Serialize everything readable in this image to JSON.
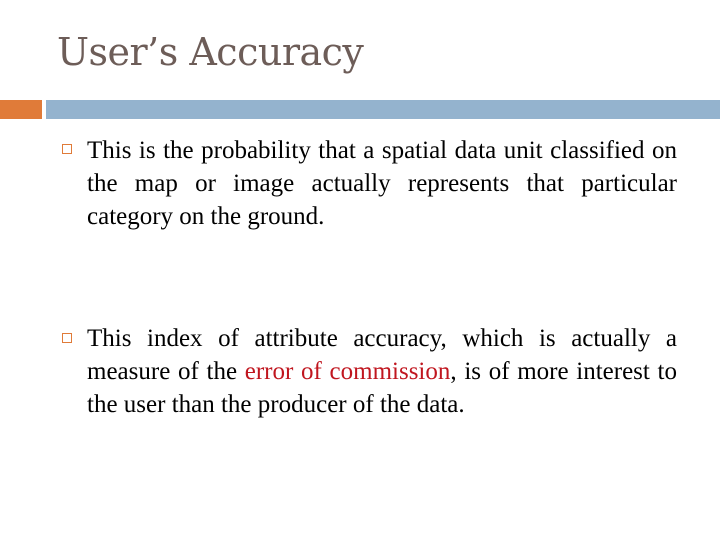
{
  "slide": {
    "title": "User’s Accuracy",
    "bullets": [
      {
        "text": "This is the probability that a spatial data unit classified on the map or image actually represents that particular category on the ground."
      },
      {
        "text_before": "This index of attribute accuracy, which is actually a measure of the ",
        "highlight": "error of commission",
        "text_after": ", is of more interest to the user than the producer of the data."
      }
    ],
    "colors": {
      "accent_orange": "#e07b39",
      "accent_blue": "#94b3ce",
      "title": "#6d5d58",
      "highlight_red": "#c0161f"
    }
  }
}
